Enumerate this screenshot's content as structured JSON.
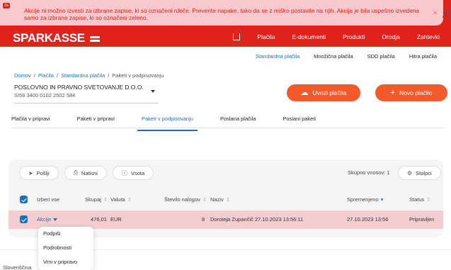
{
  "toast": {
    "tag": "Za",
    "message": "Akcije ni možno izvesti za izbrane zapise, ki so označeni rdeče. Preverite napake, tako da se z miško postavite na njih. Akcija je bila uspešno izvedena samo za izbrane zapise, ki so označeni zeleno.",
    "close": "×"
  },
  "header": {
    "logo": "SPARKASSE",
    "nav": [
      "Plačila",
      "E-dokumenti",
      "Produkti",
      "Orodja",
      "Zahtevki"
    ]
  },
  "subnav": [
    "Standardna plačila",
    "Množična plačila",
    "SDD plačila",
    "Hitra plačila"
  ],
  "breadcrumb": [
    "Domov",
    "/",
    "Plačila",
    "/",
    "Standardna plačila",
    "/",
    "Paketi v podpisovanju"
  ],
  "account": {
    "name": "POSLOVNO IN PRAVNO SVETOVANJE D.O.O.",
    "iban": "SI56 3400 0102 2502 584"
  },
  "buttons": {
    "upload": "Uvozi plačila",
    "new": "Novo plačilo"
  },
  "tabs": [
    "Plačila v pripravi",
    "Paketi v pripravi",
    "Paketi v podpisovanju",
    "Poslana plačila",
    "Poslani paketi"
  ],
  "toolbar": {
    "send": "Pošlji",
    "print": "Natisni",
    "sum": "Vsota",
    "total": "Skupno vnosov: 1",
    "columns": "Stolpci"
  },
  "table": {
    "headers": [
      "Izberi vse",
      "Skupaj",
      "Valuta",
      "Število nalogov",
      "Naziv",
      "Spremenjeno",
      "Status"
    ],
    "row": {
      "action": "Akcije",
      "amount": "476,01",
      "currency": "EUR",
      "count": "8",
      "name": "Doroteja Zupančič 27.10.2023 13:56:11",
      "modified": "27.10.2023 13:56",
      "status": "Pripravljen"
    }
  },
  "dropdown": [
    "Podpiši",
    "Podrobnosti",
    "Vrni v pripravo"
  ],
  "footer": {
    "language": "Slovenščina"
  }
}
